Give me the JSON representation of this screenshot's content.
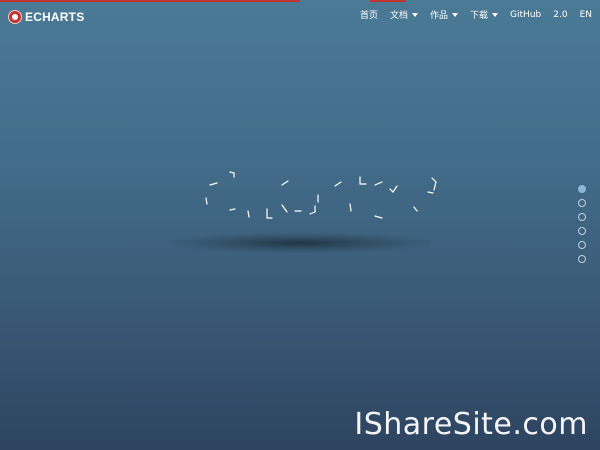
{
  "brand": {
    "name": "ECHARTS",
    "logo_icon": "echarts-logo-icon",
    "accent_color": "#c23531"
  },
  "nav": {
    "items": [
      {
        "label": "首页",
        "has_dropdown": false
      },
      {
        "label": "文档",
        "has_dropdown": true
      },
      {
        "label": "作品",
        "has_dropdown": true
      },
      {
        "label": "下载",
        "has_dropdown": true
      },
      {
        "label": "GitHub",
        "has_dropdown": false
      },
      {
        "label": "2.0",
        "has_dropdown": false
      },
      {
        "label": "EN",
        "has_dropdown": false
      }
    ]
  },
  "pager": {
    "count": 6,
    "active_index": 0
  },
  "watermark": {
    "text": "IShareSite.com"
  }
}
